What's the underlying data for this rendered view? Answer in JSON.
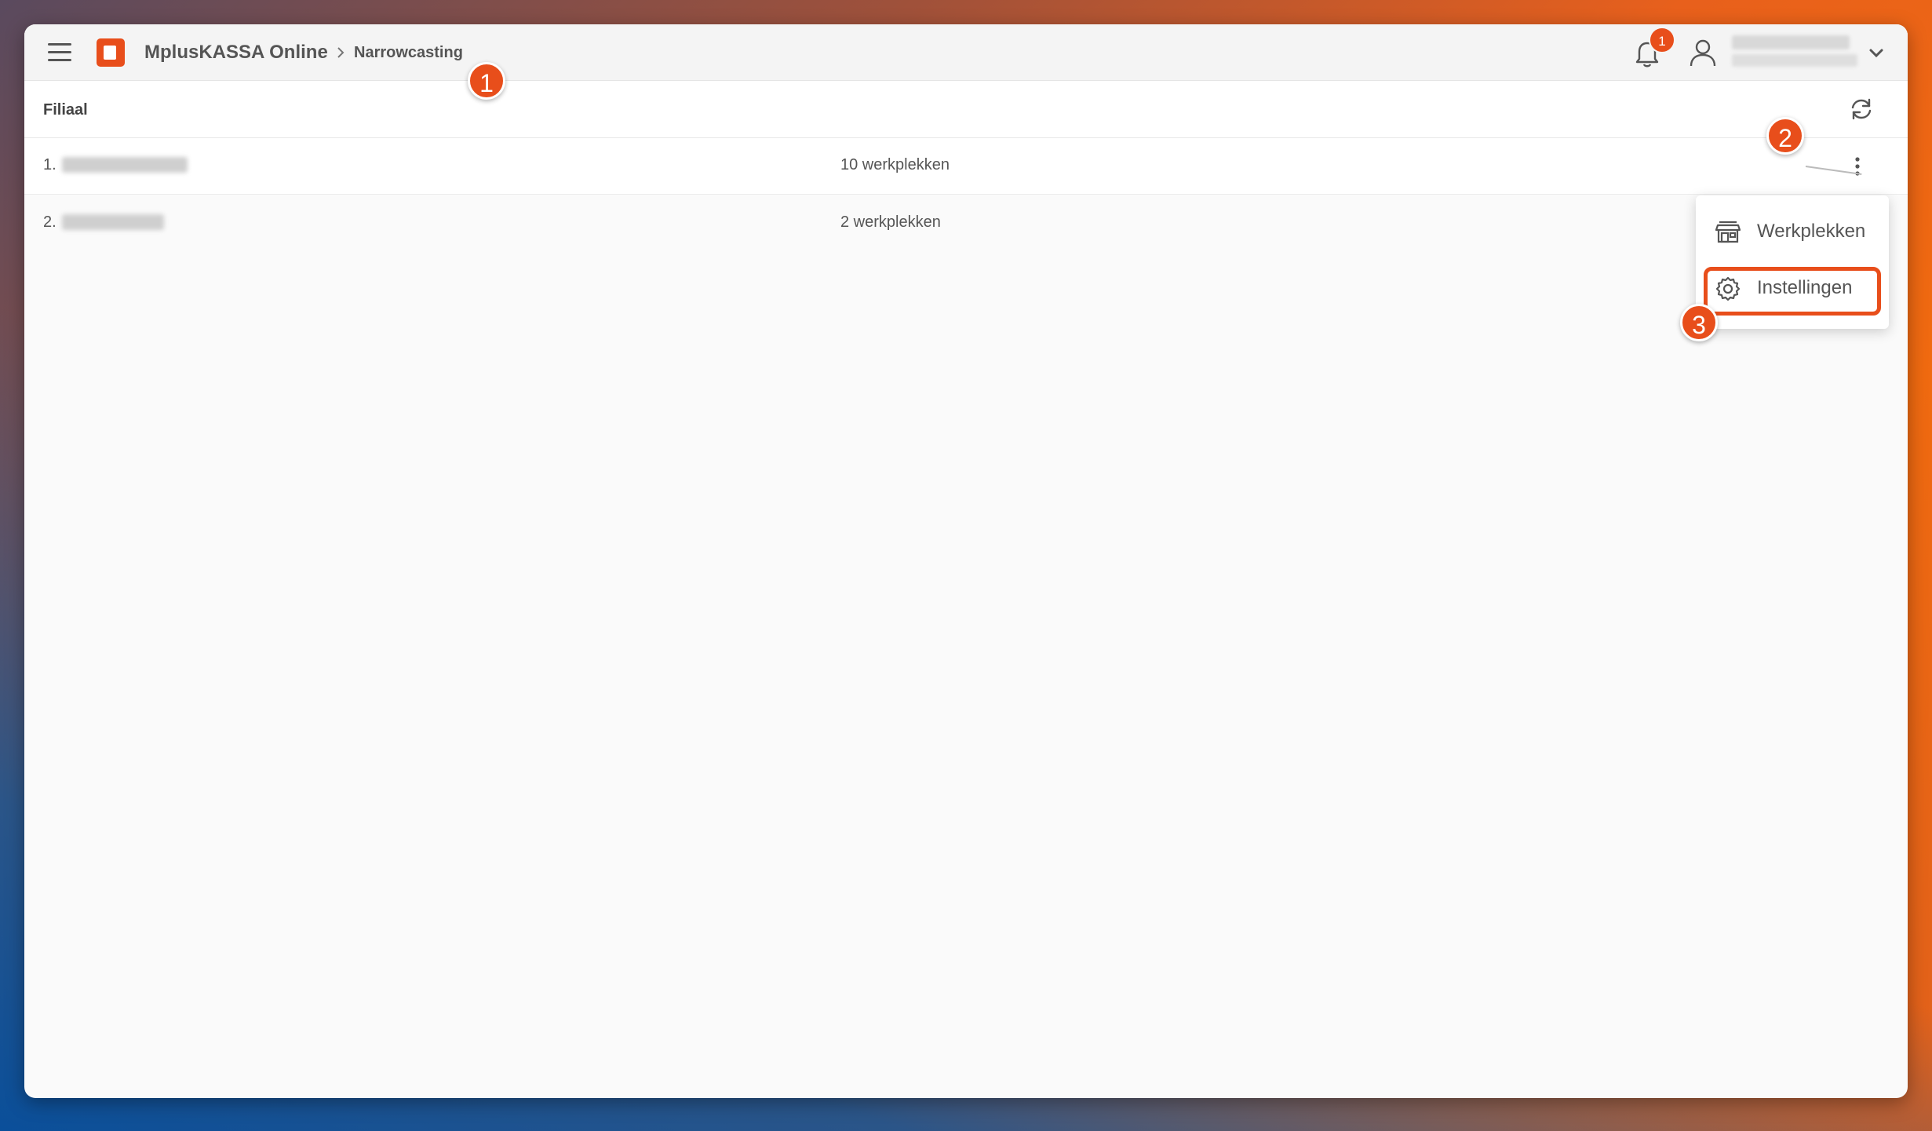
{
  "header": {
    "app_title": "MplusKASSA Online",
    "breadcrumb_sep": ">",
    "breadcrumb": "Narrowcasting",
    "notification_count": "1"
  },
  "table": {
    "column_title": "Filiaal",
    "rows": [
      {
        "num": "1.",
        "count": "10 werkplekken"
      },
      {
        "num": "2.",
        "count": "2 werkplekken"
      }
    ]
  },
  "menu": {
    "items": [
      {
        "label": "Werkplekken",
        "icon": "store-icon"
      },
      {
        "label": "Instellingen",
        "icon": "gear-icon"
      }
    ]
  },
  "annotations": {
    "step1": "1",
    "step2": "2",
    "step3": "3"
  },
  "colors": {
    "accent": "#e84e1b"
  }
}
